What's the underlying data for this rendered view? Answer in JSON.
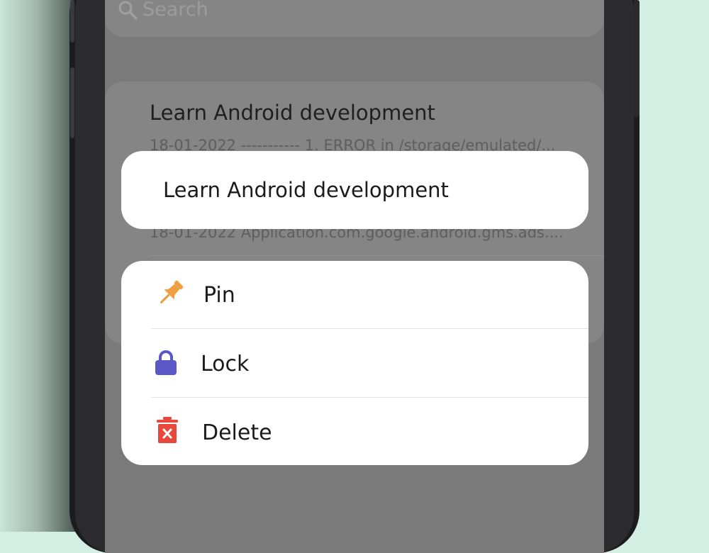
{
  "search": {
    "placeholder": "Search"
  },
  "notes": {
    "first_title": "Learn Android development",
    "first_snippet": "18-01-2022 ----------- 1. ERROR in /storage/emulated/...",
    "second_snippet": "18-01-2022 Application.com.google.android.gms.ads...."
  },
  "popup": {
    "title": "Learn Android development",
    "actions": [
      {
        "label": "Pin",
        "icon": "pushpin-icon",
        "color": "#f0a043"
      },
      {
        "label": "Lock",
        "icon": "lock-icon",
        "color": "#5a57c7"
      },
      {
        "label": "Delete",
        "icon": "trash-icon",
        "color": "#e8473b"
      }
    ]
  },
  "colors": {
    "background": "#d3eee2",
    "overlay": "#7a7a7a",
    "card": "#ffffff"
  }
}
